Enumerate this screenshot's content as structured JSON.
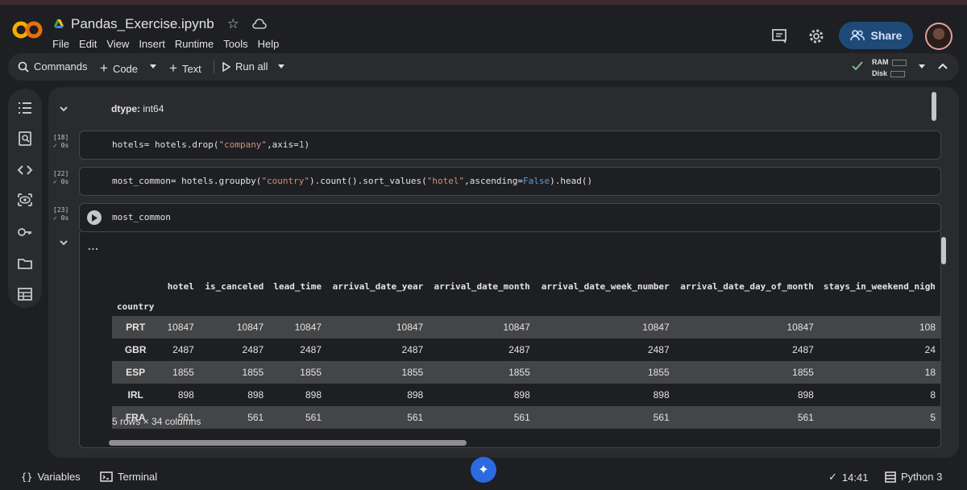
{
  "app": {
    "logo": "CO",
    "file_name": "Pandas_Exercise.ipynb"
  },
  "menus": [
    "File",
    "Edit",
    "View",
    "Insert",
    "Runtime",
    "Tools",
    "Help"
  ],
  "header": {
    "share_label": "Share"
  },
  "toolbar": {
    "commands": "Commands",
    "code": "Code",
    "text": "Text",
    "run_all": "Run all",
    "ram": "RAM",
    "disk": "Disk"
  },
  "cells": {
    "prev_output": {
      "label": "dtype:",
      "value": "int64"
    },
    "c18": {
      "count": "[18]",
      "time": "0s",
      "code": [
        "hotels= hotels.drop(",
        "\"company\"",
        ",axis=",
        "1",
        ")"
      ]
    },
    "c22": {
      "count": "[22]",
      "time": "0s",
      "code": [
        "most_common= hotels.groupby(",
        "\"country\"",
        ").count().sort_values(",
        "\"hotel\"",
        ",ascending=",
        "False",
        ").head()"
      ]
    },
    "c23": {
      "count": "[23]",
      "time": "0s",
      "code": "most_common",
      "output_menu": "..."
    }
  },
  "table": {
    "columns": [
      "hotel",
      "is_canceled",
      "lead_time",
      "arrival_date_year",
      "arrival_date_month",
      "arrival_date_week_number",
      "arrival_date_day_of_month",
      "stays_in_weekend_nigh"
    ],
    "index_name": "country",
    "rows": [
      {
        "idx": "PRT",
        "cells": [
          "10847",
          "10847",
          "10847",
          "10847",
          "10847",
          "10847",
          "10847",
          "108"
        ]
      },
      {
        "idx": "GBR",
        "cells": [
          "2487",
          "2487",
          "2487",
          "2487",
          "2487",
          "2487",
          "2487",
          "24"
        ]
      },
      {
        "idx": "ESP",
        "cells": [
          "1855",
          "1855",
          "1855",
          "1855",
          "1855",
          "1855",
          "1855",
          "18"
        ]
      },
      {
        "idx": "IRL",
        "cells": [
          "898",
          "898",
          "898",
          "898",
          "898",
          "898",
          "898",
          "8"
        ]
      },
      {
        "idx": "FRA",
        "cells": [
          "561",
          "561",
          "561",
          "561",
          "561",
          "561",
          "561",
          "5"
        ]
      }
    ],
    "summary": "5 rows × 34 columns"
  },
  "statusbar": {
    "variables": "Variables",
    "terminal": "Terminal",
    "time": "14:41",
    "runtime": "Python 3"
  }
}
